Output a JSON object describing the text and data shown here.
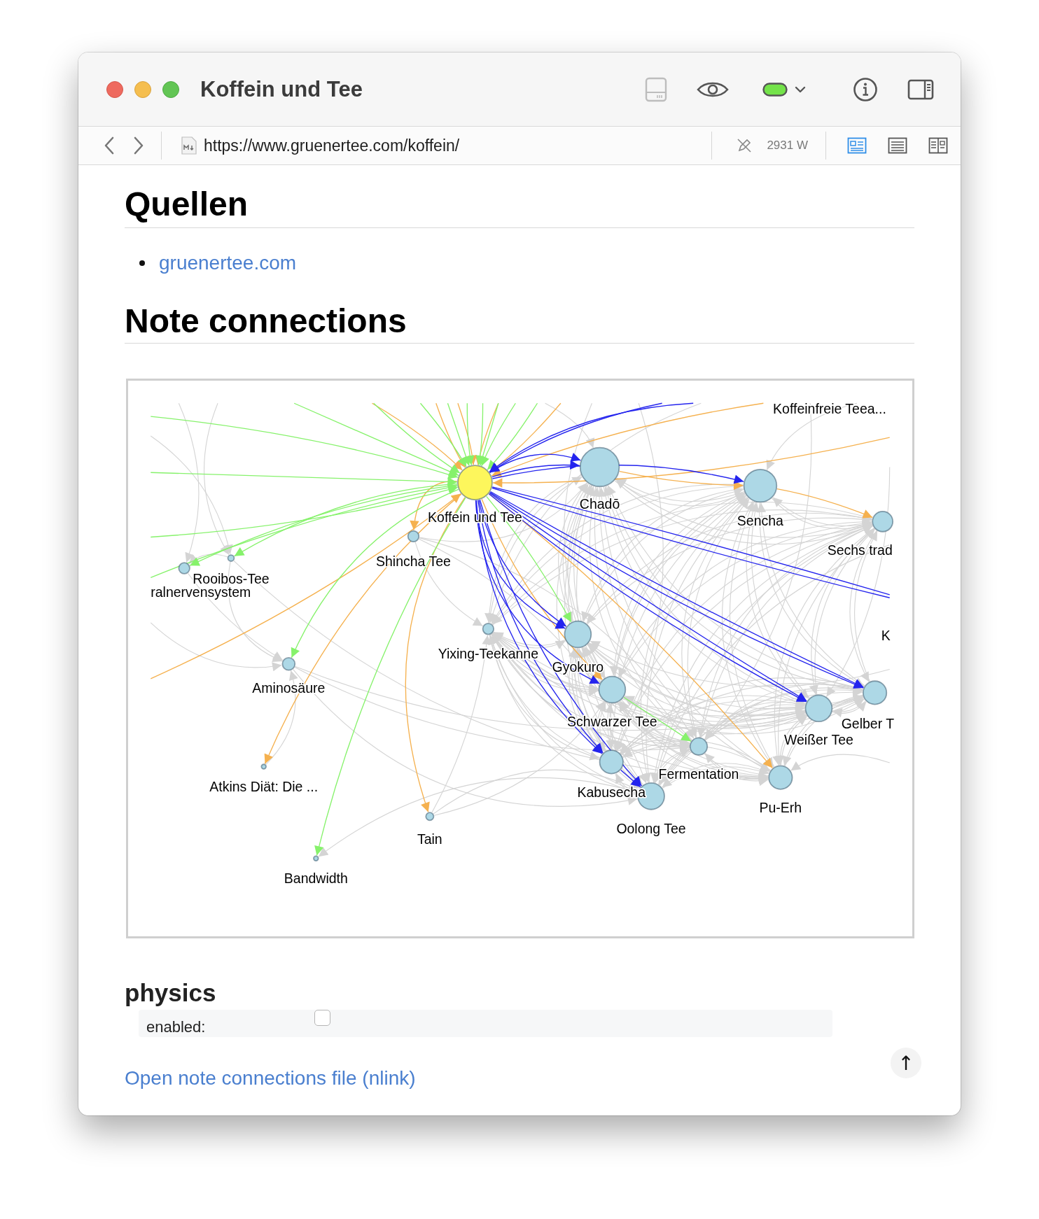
{
  "window": {
    "title": "Koffein und Tee",
    "status_indicator": {
      "on": true
    }
  },
  "address_bar": {
    "url": "https://www.gruenertee.com/koffein/",
    "word_count": "2931 W",
    "view_modes": [
      {
        "kind": "preview",
        "selected": true
      },
      {
        "kind": "text",
        "selected": false
      },
      {
        "kind": "split",
        "selected": false
      }
    ]
  },
  "sources": {
    "heading": "Quellen",
    "links": [
      "gruenertee.com"
    ]
  },
  "connections": {
    "heading": "Note connections",
    "graph": {
      "nodes": [
        {
          "label": "Koffein und Tee",
          "color": "#fdf65c"
        },
        {
          "label": "Chadō",
          "color": "#add8e6"
        },
        {
          "label": "Sencha",
          "color": "#add8e6"
        },
        {
          "label": "Sechs trad",
          "color": "#add8e6"
        },
        {
          "label": "Shincha Tee",
          "color": "#add8e6"
        },
        {
          "label": "Rooibos-Tee",
          "color": "#add8e6"
        },
        {
          "label": "ralnervensystem",
          "color": "#add8e6"
        },
        {
          "label": "Yixing-Teekanne",
          "color": "#add8e6"
        },
        {
          "label": "Gyokuro",
          "color": "#add8e6"
        },
        {
          "label": "Aminosäure",
          "color": "#add8e6"
        },
        {
          "label": "Schwarzer Tee",
          "color": "#add8e6"
        },
        {
          "label": "Weißer Tee",
          "color": "#add8e6"
        },
        {
          "label": "Gelber T",
          "color": "#add8e6"
        },
        {
          "label": "Fermentation",
          "color": "#add8e6"
        },
        {
          "label": "Pu-Erh",
          "color": "#add8e6"
        },
        {
          "label": "Kabusecha",
          "color": "#add8e6"
        },
        {
          "label": "Oolong Tee",
          "color": "#add8e6"
        },
        {
          "label": "Atkins Diät: Die ...",
          "color": "#add8e6"
        },
        {
          "label": "Tain",
          "color": "#add8e6"
        },
        {
          "label": "Bandwidth",
          "color": "#add8e6"
        }
      ],
      "cut_labels": [
        "Koffeinfreie Teea...",
        "K"
      ]
    }
  },
  "physics": {
    "heading": "physics",
    "enabled_label": "enabled:",
    "enabled": false
  },
  "open_link": "Open note connections file (nlink)",
  "scroll_top_button": "↑"
}
